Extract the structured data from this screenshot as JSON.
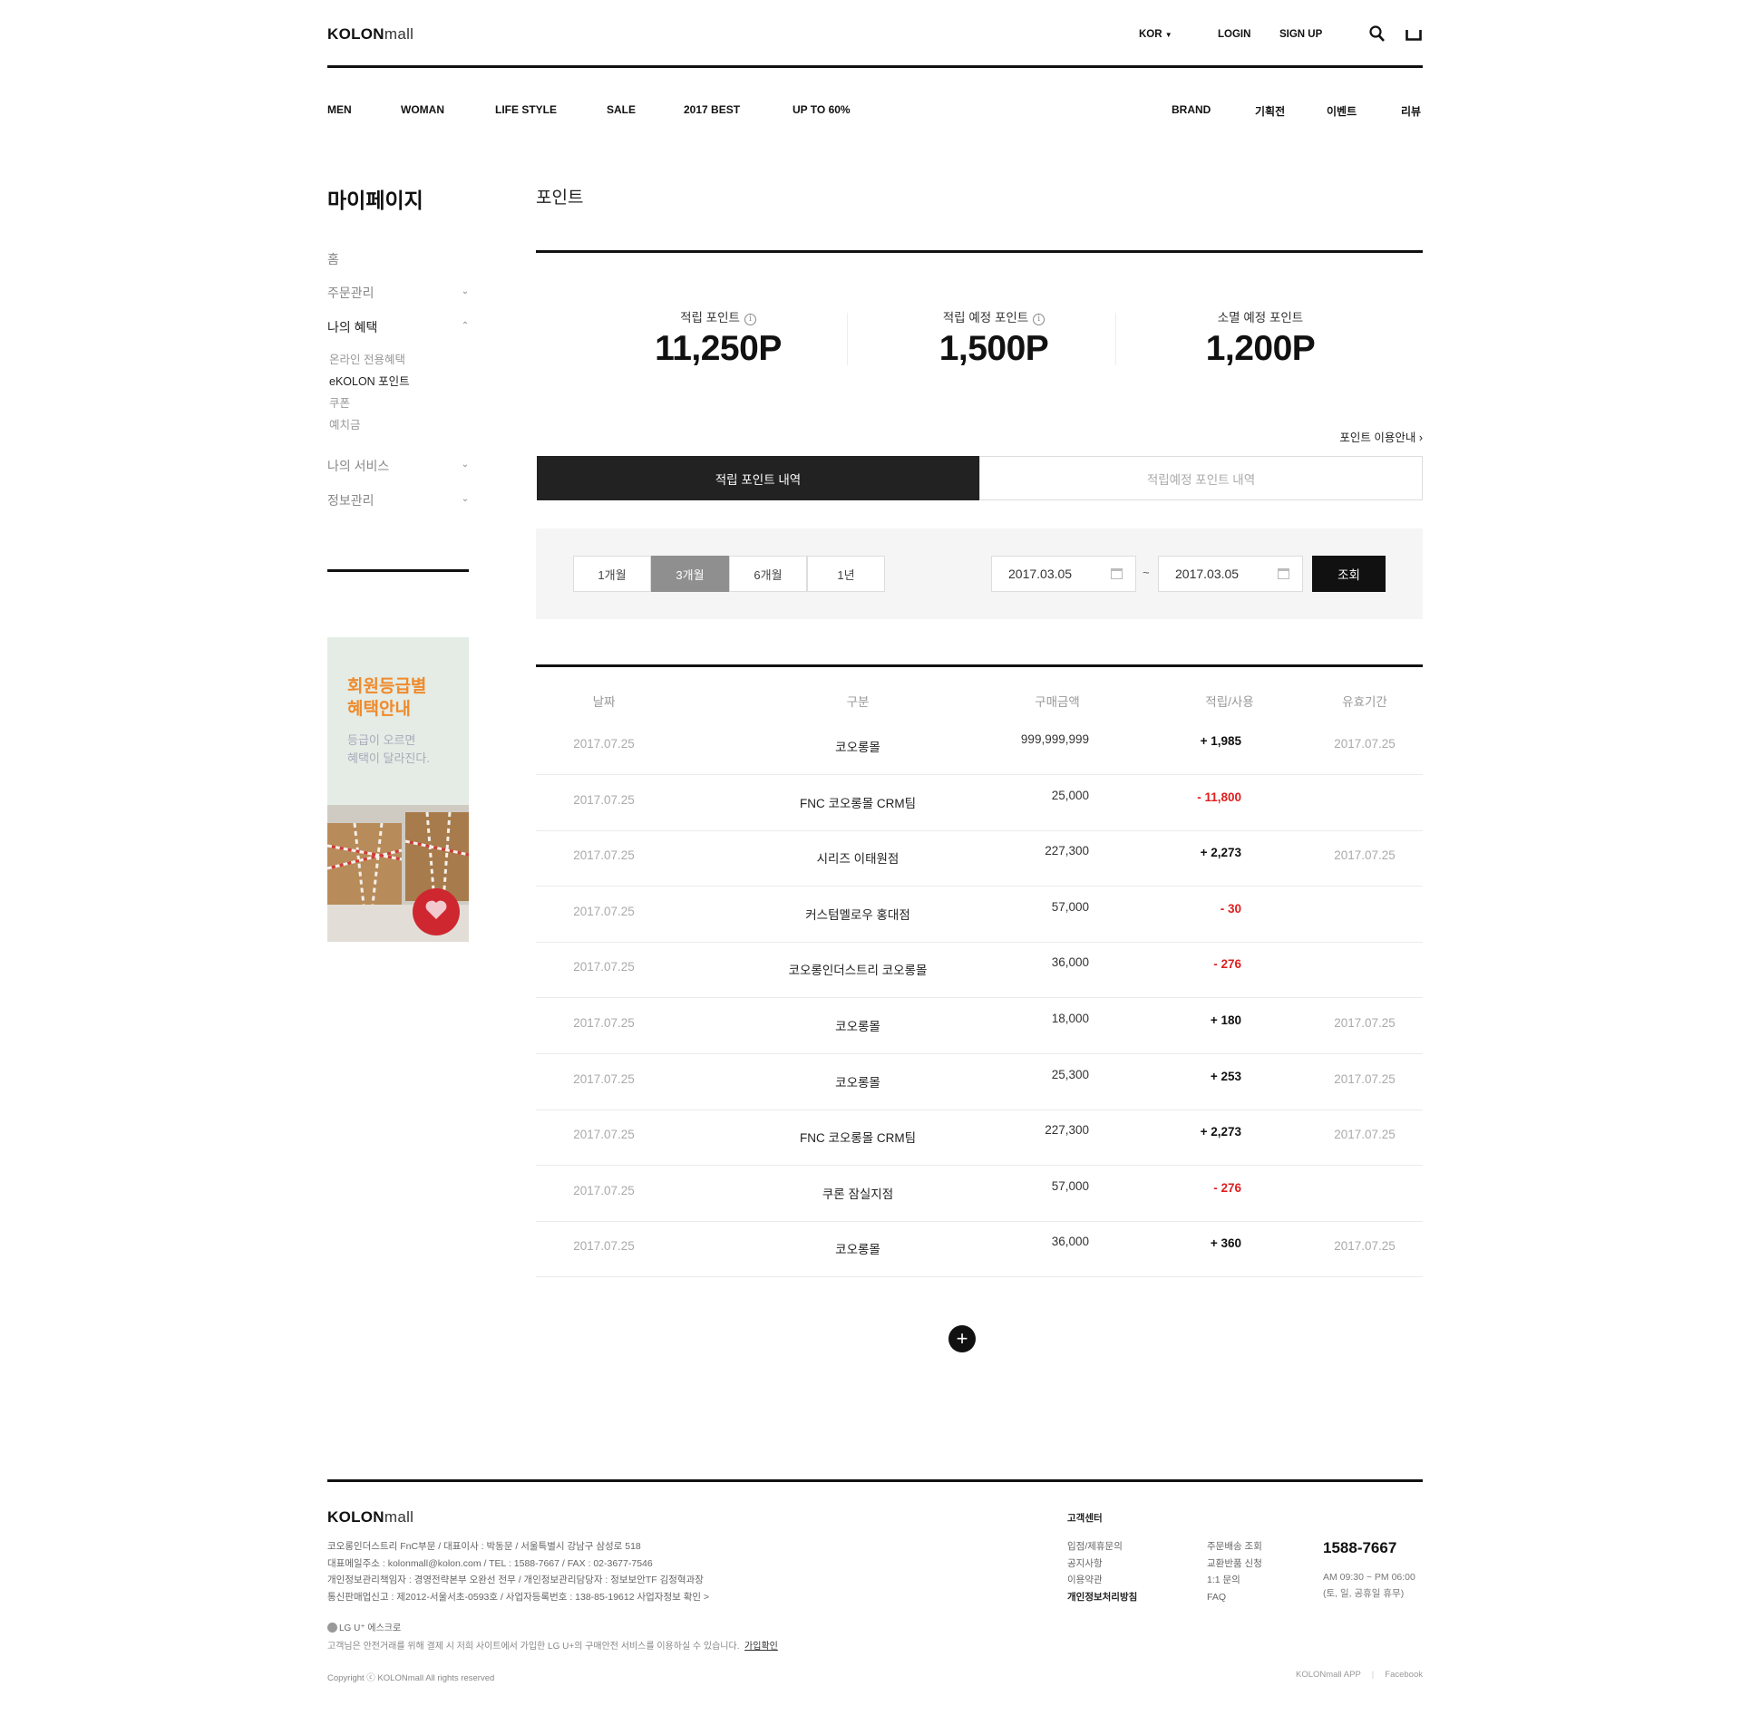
{
  "header": {
    "logo_bold": "KOLON",
    "logo_light": "mall",
    "language": "KOR",
    "login": "LOGIN",
    "signup": "SIGN UP",
    "icons": [
      "search-icon",
      "shopping-bag-icon"
    ]
  },
  "gnb": {
    "left": [
      "MEN",
      "WOMAN",
      "LIFE STYLE",
      "SALE",
      "2017 BEST",
      "UP TO 60%"
    ],
    "right": [
      "BRAND",
      "기획전",
      "이벤트",
      "리뷰"
    ]
  },
  "sidebar": {
    "title": "마이페이지",
    "home": "홈",
    "order": "주문관리",
    "benefit": "나의 혜택",
    "sub": [
      "온라인 전용혜택",
      "eKOLON 포인트",
      "쿠폰",
      "예치금"
    ],
    "service": "나의 서비스",
    "info": "정보관리",
    "banner_title": [
      "회원등급별",
      "혜택안내"
    ],
    "banner_desc": [
      "등급이 오르면",
      "혜택이 달라진다."
    ]
  },
  "main": {
    "title": "포인트",
    "summary": [
      {
        "label": "적립 포인트",
        "value": "11,250",
        "unit": "P"
      },
      {
        "label": "적립 예정 포인트",
        "value": "1,500",
        "unit": "P"
      },
      {
        "label": "소멸 예정 포인트",
        "value": "1,200",
        "unit": "P"
      }
    ],
    "guide_link": "포인트 이용안내",
    "tabs": [
      "적립 포인트 내역",
      "적립예정 포인트 내역"
    ],
    "periods": [
      "1개월",
      "3개월",
      "6개월",
      "1년"
    ],
    "selected_period": "3개월",
    "date_from": "2017.03.05",
    "date_to": "2017.03.05",
    "date_sep": "~",
    "search_button": "조회",
    "columns": [
      "날짜",
      "구분",
      "구매금액",
      "적립/사용",
      "유효기간"
    ],
    "rows": [
      {
        "date": "2017.07.25",
        "name": "코오롱몰",
        "amount": "999,999,999",
        "points": "+ 1,985",
        "expiry": "2017.07.25"
      },
      {
        "date": "2017.07.25",
        "name": "FNC 코오롱몰 CRM팀",
        "amount": "25,000",
        "points": "- 11,800",
        "expiry": ""
      },
      {
        "date": "2017.07.25",
        "name": "시리즈 이태원점",
        "amount": "227,300",
        "points": "+ 2,273",
        "expiry": "2017.07.25"
      },
      {
        "date": "2017.07.25",
        "name": "커스텀멜로우 홍대점",
        "amount": "57,000",
        "points": "- 30",
        "expiry": ""
      },
      {
        "date": "2017.07.25",
        "name": "코오롱인더스트리 코오롱몰",
        "amount": "36,000",
        "points": "- 276",
        "expiry": ""
      },
      {
        "date": "2017.07.25",
        "name": "코오롱몰",
        "amount": "18,000",
        "points": "+ 180",
        "expiry": "2017.07.25"
      },
      {
        "date": "2017.07.25",
        "name": "코오롱몰",
        "amount": "25,300",
        "points": "+ 253",
        "expiry": "2017.07.25"
      },
      {
        "date": "2017.07.25",
        "name": "FNC 코오롱몰 CRM팀",
        "amount": "227,300",
        "points": "+ 2,273",
        "expiry": "2017.07.25"
      },
      {
        "date": "2017.07.25",
        "name": "쿠론 잠실지점",
        "amount": "57,000",
        "points": "- 276",
        "expiry": ""
      },
      {
        "date": "2017.07.25",
        "name": "코오롱몰",
        "amount": "36,000",
        "points": "+ 360",
        "expiry": "2017.07.25"
      }
    ],
    "more_button": "+"
  },
  "footer": {
    "info_lines": [
      "코오롱인더스트리 FnC부문 / 대표이사 : 박동문 / 서울특별시 강남구 삼성로 518",
      "대표메일주소 : kolonmall@kolon.com / TEL : 1588-7667 / FAX : 02-3677-7546",
      "개인정보관리책임자 : 경영전략본부 오완선 전무 / 개인정보관리담당자 : 정보보안TF 김정혁과장",
      "통신판매업신고 : 제2012-서울서초-0593호 / 사업자등록번호 : 138-85-19612  사업자정보 확인 >"
    ],
    "lgu": "LG U⁺ 에스크로",
    "escrow_text": "고객님은 안전거래를 위해 결제 시 저희 사이트에서 가입한 LG U+의 구매안전 서비스를 이용하실 수 있습니다.",
    "escrow_link": "가입확인",
    "copyright": "Copyright ⓒ KOLONmall All rights reserved",
    "cs_title": "고객센터",
    "cs_col1": [
      "입점/제휴문의",
      "공지사항",
      "이용약관",
      "개인정보처리방침"
    ],
    "cs_col2": [
      "주문배송 조회",
      "교환반품 신청",
      "1:1 문의",
      "FAQ"
    ],
    "cs_phone": "1588-7667",
    "cs_hours": [
      "AM 09:30 ~ PM 06:00",
      "(토, 일, 공휴일 휴무)"
    ],
    "links": [
      "KOLONmall APP",
      "Facebook"
    ]
  },
  "colors": {
    "accent_dark": "#111111",
    "negative": "#e01e1e",
    "banner_title": "#f08a2c",
    "banner_bg": "#e4ece5"
  }
}
